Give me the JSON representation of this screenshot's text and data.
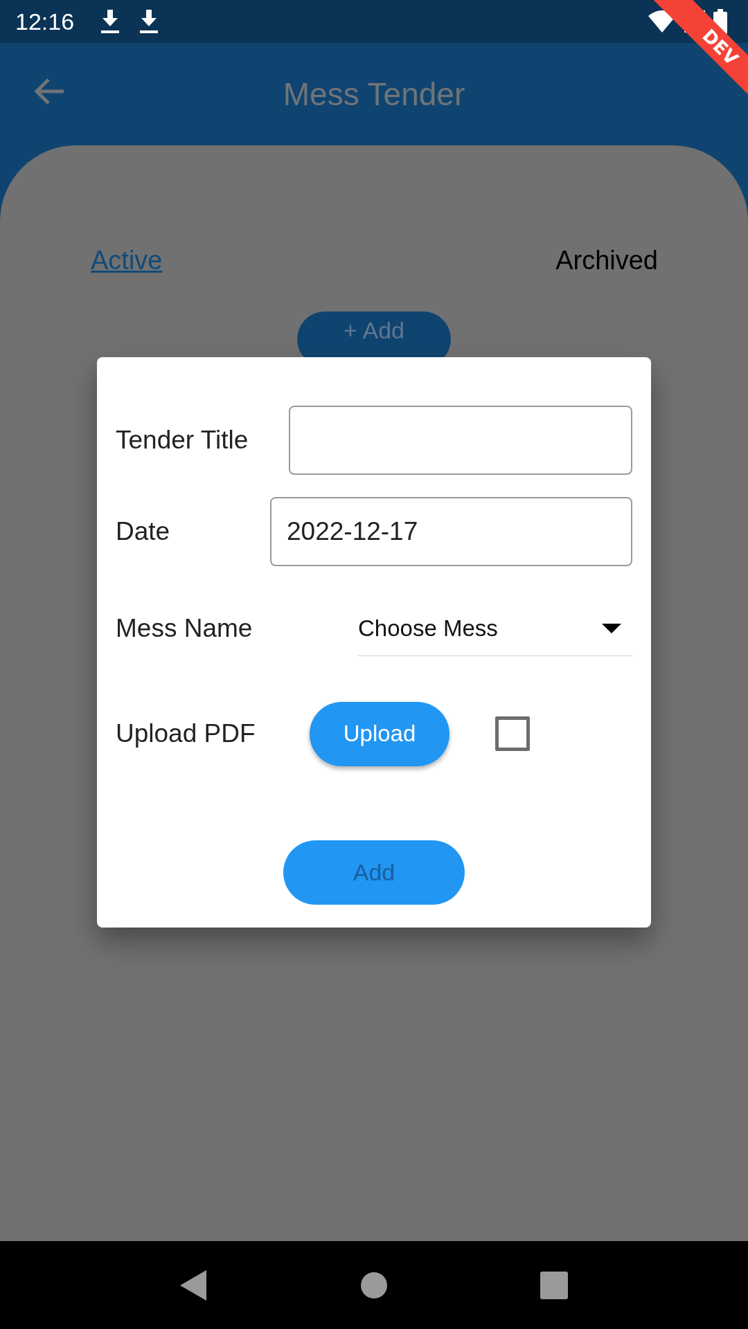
{
  "status_bar": {
    "time": "12:16"
  },
  "debug_banner": {
    "label": "DEV"
  },
  "app_bar": {
    "title": "Mess Tender"
  },
  "tabs": [
    {
      "label": "Active",
      "selected": true
    },
    {
      "label": "Archived",
      "selected": false
    }
  ],
  "add_button": {
    "label": "+ Add"
  },
  "dialog": {
    "rows": [
      {
        "kind": "text",
        "label": "Tender Title"
      },
      {
        "kind": "date",
        "label": "Date",
        "value": "2022-12-17"
      },
      {
        "kind": "dropdown",
        "label": "Mess Name",
        "placeholder": "Choose Mess"
      },
      {
        "kind": "upload",
        "label": "Upload PDF",
        "button": "Upload",
        "checked": false
      }
    ],
    "submit": "Add"
  }
}
